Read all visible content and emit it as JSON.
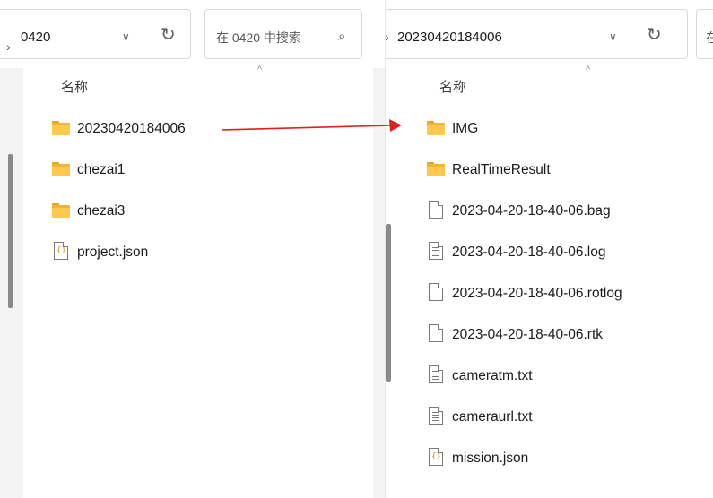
{
  "left": {
    "address": {
      "sep": "›",
      "path": "0420",
      "chevron": "∨",
      "refresh": "↻"
    },
    "search": {
      "placeholder": "在 0420 中搜索",
      "icon": "⌕"
    },
    "header": {
      "name": "名称",
      "sort_caret": "^"
    },
    "items": [
      {
        "label": "20230420184006",
        "icon": "folder-icon"
      },
      {
        "label": "chezai1",
        "icon": "folder-icon"
      },
      {
        "label": "chezai3",
        "icon": "folder-icon"
      },
      {
        "label": "project.json",
        "icon": "json-file-icon"
      }
    ]
  },
  "right": {
    "address": {
      "sep": "›",
      "path": "20230420184006",
      "chevron": "∨",
      "refresh": "↻"
    },
    "search": {
      "placeholder_partial": "在"
    },
    "header": {
      "name": "名称",
      "sort_caret": "^"
    },
    "items": [
      {
        "label": "IMG",
        "icon": "folder-icon"
      },
      {
        "label": "RealTimeResult",
        "icon": "folder-icon"
      },
      {
        "label": "2023-04-20-18-40-06.bag",
        "icon": "blank-file-icon"
      },
      {
        "label": "2023-04-20-18-40-06.log",
        "icon": "text-file-icon"
      },
      {
        "label": "2023-04-20-18-40-06.rotlog",
        "icon": "blank-file-icon"
      },
      {
        "label": "2023-04-20-18-40-06.rtk",
        "icon": "blank-file-icon"
      },
      {
        "label": "cameratm.txt",
        "icon": "text-file-icon"
      },
      {
        "label": "cameraurl.txt",
        "icon": "text-file-icon"
      },
      {
        "label": "mission.json",
        "icon": "json-file-icon"
      }
    ]
  },
  "annotation": {
    "arrow_color": "#e0201c"
  },
  "colors": {
    "folder": "#ffc94d",
    "scrollbar": "#8a8a8a"
  }
}
